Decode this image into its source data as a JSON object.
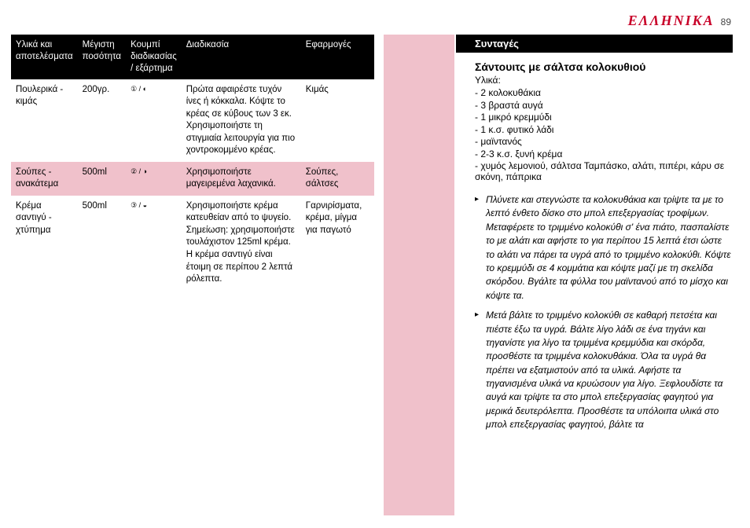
{
  "header": {
    "brand": "ΕΛΛΗΝΙΚΑ",
    "page_number": "89"
  },
  "table": {
    "headers": [
      "Υλικά και αποτελέσματα",
      "Μέγιστη ποσότητα",
      "Κουμπί διαδικασίας / εξάρτημα",
      "Διαδικασία",
      "Εφαρμογές"
    ],
    "rows": [
      {
        "c0": "Πουλερικά - κιμάς",
        "c1": "200γρ.",
        "c2": "① / ◐",
        "c3": "Πρώτα αφαιρέστε τυχόν ίνες ή κόκκαλα. Κόψτε το κρέας σε κύβους των 3 εκ. Χρησιμοποιήστε τη στιγμιαία λειτουργία για πιο χοντροκομμένο κρέας.",
        "c4": "Κιμάς"
      },
      {
        "c0": "Σούπες - ανακάτεμα",
        "c1": "500ml",
        "c2": "② / ◑",
        "c3": "Χρησιμοποιήστε μαγειρεμένα λαχανικά.",
        "c4": "Σούπες, σάλτσες"
      },
      {
        "c0": "Κρέμα σαντιγύ - χτύπημα",
        "c1": "500ml",
        "c2": "③ / ◒",
        "c3": "Χρησιμοποιήστε κρέμα κατευθείαν από το ψυγείο. Σημείωση: χρησιμοποιήστε τουλάχιστον 125ml κρέμα. Η κρέμα σαντιγύ είναι έτοιμη σε περίπου 2 λεπτά ρόλεπτα.",
        "c4": "Γαρνιρίσματα, κρέμα, μίγμα για παγωτό"
      }
    ]
  },
  "recipes": {
    "section_title": "Συνταγές",
    "title": "Σάντουιτς με σάλτσα κολοκυθιού",
    "ingredients_label": "Υλικά:",
    "ingredients": [
      "2 κολοκυθάκια",
      "3 βραστά αυγά",
      "1 μικρό κρεμμύδι",
      "1 κ.σ. φυτικό λάδι",
      "μαϊντανός",
      "2-3 κ.σ. ξυνή κρέμα",
      "χυμός λεμονιού, σάλτσα Ταμπάσκο, αλάτι, πιπέρι, κάρυ σε σκόνη, πάπρικα"
    ],
    "steps": [
      "Πλύνετε και στεγνώστε τα κολοκυθάκια και τρίψτε τα με το λεπτό ένθετο δίσκο στο μπολ επεξεργασίας τροφίμων. Μεταφέρετε το τριμμένο κολοκύθι σ' ένα πιάτο, πασπαλίστε το με αλάτι και αφήστε το για περίπου 15 λεπτά έτσι ώστε το αλάτι να πάρει τα υγρά από το τριμμένο κολοκύθι. Κόψτε το κρεμμύδι σε 4 κομμάτια και κόψτε μαζί με τη σκελίδα σκόρδου. Βγάλτε τα φύλλα του μαϊντανού από το μίσχο και κόψτε τα.",
      "Μετά βάλτε το τριμμένο κολοκύθι σε καθαρή πετσέτα και πιέστε έξω τα υγρά. Βάλτε λίγο λάδι σε ένα τηγάνι και τηγανίστε για λίγο τα τριμμένα κρεμμύδια και σκόρδα, προσθέστε τα τριμμένα κολοκυθάκια. Όλα τα υγρά θα πρέπει να εξατμιστούν από τα υλικά. Αφήστε τα τηγανισμένα υλικά να κρυώσουν για λίγο. Ξεφλουδίστε τα αυγά και τρίψτε τα στο μπολ επεξεργασίας φαγητού για μερικά δευτερόλεπτα. Προσθέστε τα υπόλοιπα υλικά στο μπολ επεξεργασίας φαγητού, βάλτε τα"
    ]
  }
}
